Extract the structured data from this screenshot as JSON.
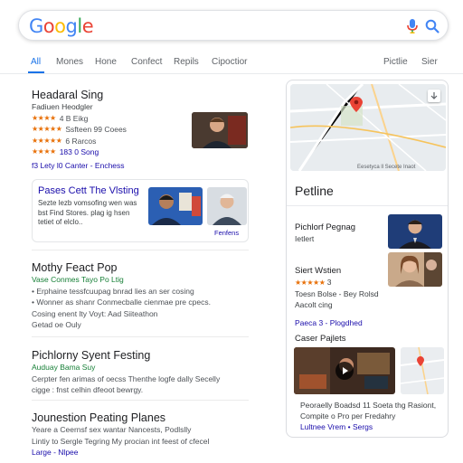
{
  "search": {
    "logo_letters": [
      {
        "ch": "G",
        "color": "#4285F4"
      },
      {
        "ch": "o",
        "color": "#EA4335"
      },
      {
        "ch": "o",
        "color": "#FBBC05"
      },
      {
        "ch": "g",
        "color": "#4285F4"
      },
      {
        "ch": "l",
        "color": "#34A853"
      },
      {
        "ch": "e",
        "color": "#EA4335"
      }
    ],
    "mic_icon": "microphone-icon",
    "search_icon": "magnifier-icon"
  },
  "tabs": {
    "items": [
      "All",
      "Mones",
      "Hone",
      "Confect",
      "Repils",
      "Cipoctior"
    ],
    "right_items": [
      "Pictlie",
      "Sier"
    ],
    "active_index": 0
  },
  "result1": {
    "title": "Headaral Sing",
    "subtitle": "Fadiuen Heodgler",
    "ratings": [
      {
        "stars": "★★★★",
        "text": "4 B Eikg"
      },
      {
        "stars": "★★★★★",
        "text": "Ssfteen 99 Coees"
      },
      {
        "stars": "★★★★★",
        "text": "6 Rarcos"
      },
      {
        "stars": "★★★★",
        "text": "183 0 Song"
      }
    ],
    "links": "f3 Lety   l0 Canter - Enchess"
  },
  "visit_card": {
    "title": "Pases Cett The Vlsting",
    "text": "Sezte lezb vomsofing wen was bst Find Stores. plag ig hsen tetiet of elclo..",
    "link": "Fenfens"
  },
  "result2": {
    "title": "Mothy Feact Pop",
    "url": "Vase Conmes Tayo Po Ltig",
    "bullets": [
      "• Erphaine tessfcuupag bnrad lies an ser cosing",
      "• Wonner as shanr Conmecballe cienmae pre cpecs.",
      "Cosing enent lty Voyt: Aad Siiteathon",
      "Getad oe Ouly"
    ],
    "inline_link": "Aad Siiteathon"
  },
  "result3": {
    "title": "Pichlorny Syent Festing",
    "url": "Auduay Bama Suy",
    "text": [
      "Cerpter fen arimas of oecss Thenthe logfe dally Secelly",
      "cigge : fnst celhin dfeoot bewrgy."
    ]
  },
  "result4": {
    "title": "Jounestion Peating Planes",
    "text": [
      "Yeare a Ceernsf sex wantar Nancests, Podlslly",
      "Lintiy to Sergle Tegring My procian int feest of cfecel"
    ],
    "link": "Large - Nlpee"
  },
  "panel": {
    "map_caption": "Eesetyca ll Secete Inaot",
    "title": "Petline",
    "person1": {
      "name": "Pichlorf Pegnag",
      "sub": "Ietlert"
    },
    "person2": {
      "name": "Siert Wstien",
      "stars": "★★★★★",
      "score": "3",
      "line1": "Toesn Bolse - Bey Rolsd",
      "line2": "Aacolt cing"
    },
    "person2_link": "Paeca 3 - Plogdhed",
    "videos_title": "Caser Pajlets",
    "caption": [
      "Peoraelly Boadsd 11 Soeta thg Rasiont,",
      "Compite o Pro per Fredahry"
    ],
    "caption_link": "Lultnee Vrem • Sergs",
    "accent": "#1a73e8"
  }
}
